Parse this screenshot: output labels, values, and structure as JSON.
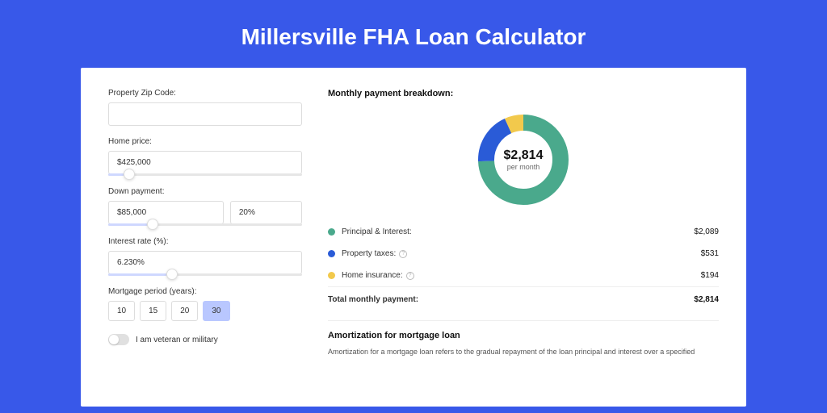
{
  "title": "Millersville FHA Loan Calculator",
  "form": {
    "zip_label": "Property Zip Code:",
    "zip_value": "",
    "home_price_label": "Home price:",
    "home_price_value": "$425,000",
    "down_payment_label": "Down payment:",
    "down_payment_value": "$85,000",
    "down_payment_pct": "20%",
    "interest_label": "Interest rate (%):",
    "interest_value": "6.230%",
    "period_label": "Mortgage period (years):",
    "periods": [
      "10",
      "15",
      "20",
      "30"
    ],
    "period_active": "30",
    "veteran_label": "I am veteran or military"
  },
  "breakdown": {
    "title": "Monthly payment breakdown:",
    "center_amount": "$2,814",
    "center_sub": "per month",
    "items": [
      {
        "label": "Principal & Interest:",
        "value": "$2,089",
        "color": "#4aa98c",
        "info": false
      },
      {
        "label": "Property taxes:",
        "value": "$531",
        "color": "#2a5bd7",
        "info": true
      },
      {
        "label": "Home insurance:",
        "value": "$194",
        "color": "#f2c94c",
        "info": true
      }
    ],
    "total_label": "Total monthly payment:",
    "total_value": "$2,814"
  },
  "amortization": {
    "title": "Amortization for mortgage loan",
    "text": "Amortization for a mortgage loan refers to the gradual repayment of the loan principal and interest over a specified"
  },
  "chart_data": {
    "type": "pie",
    "title": "Monthly payment breakdown",
    "series": [
      {
        "name": "Principal & Interest",
        "value": 2089,
        "color": "#4aa98c"
      },
      {
        "name": "Property taxes",
        "value": 531,
        "color": "#2a5bd7"
      },
      {
        "name": "Home insurance",
        "value": 194,
        "color": "#f2c94c"
      }
    ],
    "total": 2814
  }
}
